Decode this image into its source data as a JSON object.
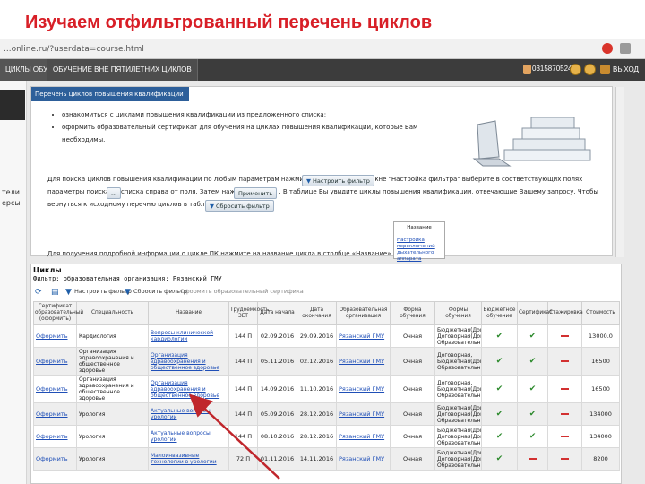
{
  "slide_title": "Изучаем отфильтрованный перечень циклов",
  "browser": {
    "url": "...online.ru/?userdata=course.html"
  },
  "topnav": {
    "tab_cycles": "ЦИКЛЫ ОБУЧЕНИЯ",
    "tab_outside": "ОБУЧЕНИЕ ВНЕ ПЯТИЛЕТНИХ ЦИКЛОВ",
    "user": "03158705246",
    "exit": "ВЫХОД"
  },
  "sidebar": {
    "s1": "тели",
    "s2": "ерсы"
  },
  "info": {
    "header": "Перечень циклов повышения квалификации",
    "bullets": [
      "ознакомиться с циклами повышения квалификации из предложенного списка;",
      "оформить образовательный сертификат для обучения на циклах повышения квалификации, которые Вам необходимы."
    ],
    "p1": "Для поиска циклов повышения квалификации по любым параметрам нажмите кнопку                      . В новом окне \"Настройка фильтра\" выберите в соответствующих полях параметры поиска из списка        справа от поля. Затем нажмите кнопку                  . В таблице Вы увидите циклы повышения квалификации, отвечающие Вашему запросу. Чтобы вернуться к исходному перечню циклов в таблице нажмите кнопку",
    "p2": "Для получения подробной информации о цикле ПК нажмите на название цикла в столбце «Название». Например:",
    "btn_filter": "Настроить фильтр",
    "btn_apply": "Применить",
    "btn_reset": "Сбросить фильтр",
    "btn_ellipsis": "...",
    "name_sample_header": "Название",
    "name_sample_link": "Настройка переключений",
    "name_sample_link2": "дыхательного аппарата"
  },
  "cycles": {
    "title": "Циклы",
    "filter": "Фильтр: образовательная организация: Рязанский ГМУ",
    "toolbar": {
      "setup": "Настроить фильтр",
      "reset": "Сбросить фильтр",
      "cert": "Оформить образовательный сертификат"
    },
    "columns": [
      "Сертификат образовательный (оформить)",
      "Специальность",
      "Название",
      "Трудоемкость, ЗЕТ",
      "Дата начала",
      "Дата окончания",
      "Образовательная организация",
      "Форма обучения",
      "Формы обучения",
      "Бюджетное обучение",
      "Сертификат",
      "Стажировка",
      "Стоимость"
    ],
    "rows": [
      {
        "action": "Оформить",
        "spec": "Кардиология",
        "name": "Вопросы клинической кардиологии",
        "hours": "144 П",
        "start": "02.09.2016",
        "end": "29.09.2016",
        "org": "Рязанский ГМУ",
        "form": "Очная",
        "forms": "Бюджетная(Доп), Договорная(Доп), Образовательный",
        "budget": "check",
        "cert": "check",
        "intern": "dash",
        "price": "13000.0"
      },
      {
        "action": "Оформить",
        "spec": "Организация здравоохранения и общественное здоровье",
        "name": "Организация здравоохранения и общественное здоровье",
        "hours": "144 П",
        "start": "05.11.2016",
        "end": "02.12.2016",
        "org": "Рязанский ГМУ",
        "form": "Очная",
        "forms": "Договорная, Бюджетная(Доп), Образовательный",
        "budget": "check",
        "cert": "check",
        "intern": "dash",
        "price": "16500"
      },
      {
        "action": "Оформить",
        "spec": "Организация здравоохранения и общественное здоровье",
        "name": "Организация здравоохранения и общественное здоровье",
        "hours": "144 П",
        "start": "14.09.2016",
        "end": "11.10.2016",
        "org": "Рязанский ГМУ",
        "form": "Очная",
        "forms": "Договорная, Бюджетная(Доп), Образовательный",
        "budget": "check",
        "cert": "check",
        "intern": "dash",
        "price": "16500"
      },
      {
        "action": "Оформить",
        "spec": "Урология",
        "name": "Актуальные вопросы урологии",
        "hours": "144 П",
        "start": "05.09.2016",
        "end": "28.12.2016",
        "org": "Рязанский ГМУ",
        "form": "Очная",
        "forms": "Бюджетная(Доп), Договорная(Доп), Образовательный",
        "budget": "check",
        "cert": "check",
        "intern": "dash",
        "price": "134000"
      },
      {
        "action": "Оформить",
        "spec": "Урология",
        "name": "Актуальные вопросы урологии",
        "hours": "144 П",
        "start": "08.10.2016",
        "end": "28.12.2016",
        "org": "Рязанский ГМУ",
        "form": "Очная",
        "forms": "Бюджетная(Доп), Договорная(Доп), Образовательный",
        "budget": "check",
        "cert": "check",
        "intern": "dash",
        "price": "134000"
      },
      {
        "action": "Оформить",
        "spec": "Урология",
        "name": "Малоинвазивные технологии в урологии",
        "hours": "72 П",
        "start": "01.11.2016",
        "end": "14.11.2016",
        "org": "Рязанский ГМУ",
        "form": "Очная",
        "forms": "Бюджетная(Доп), Договорная(Доп), Образовательный",
        "budget": "check",
        "cert": "dash",
        "intern": "dash",
        "price": "8200"
      }
    ]
  },
  "colors": {
    "title_red": "#d81f27",
    "nav_dark": "#3c3c3c",
    "panel_blue": "#2d5f9a",
    "link_blue": "#1f4fb7",
    "check_green": "#2d8a2d",
    "dash_red": "#d23030",
    "arrow_red": "#c0262c"
  }
}
